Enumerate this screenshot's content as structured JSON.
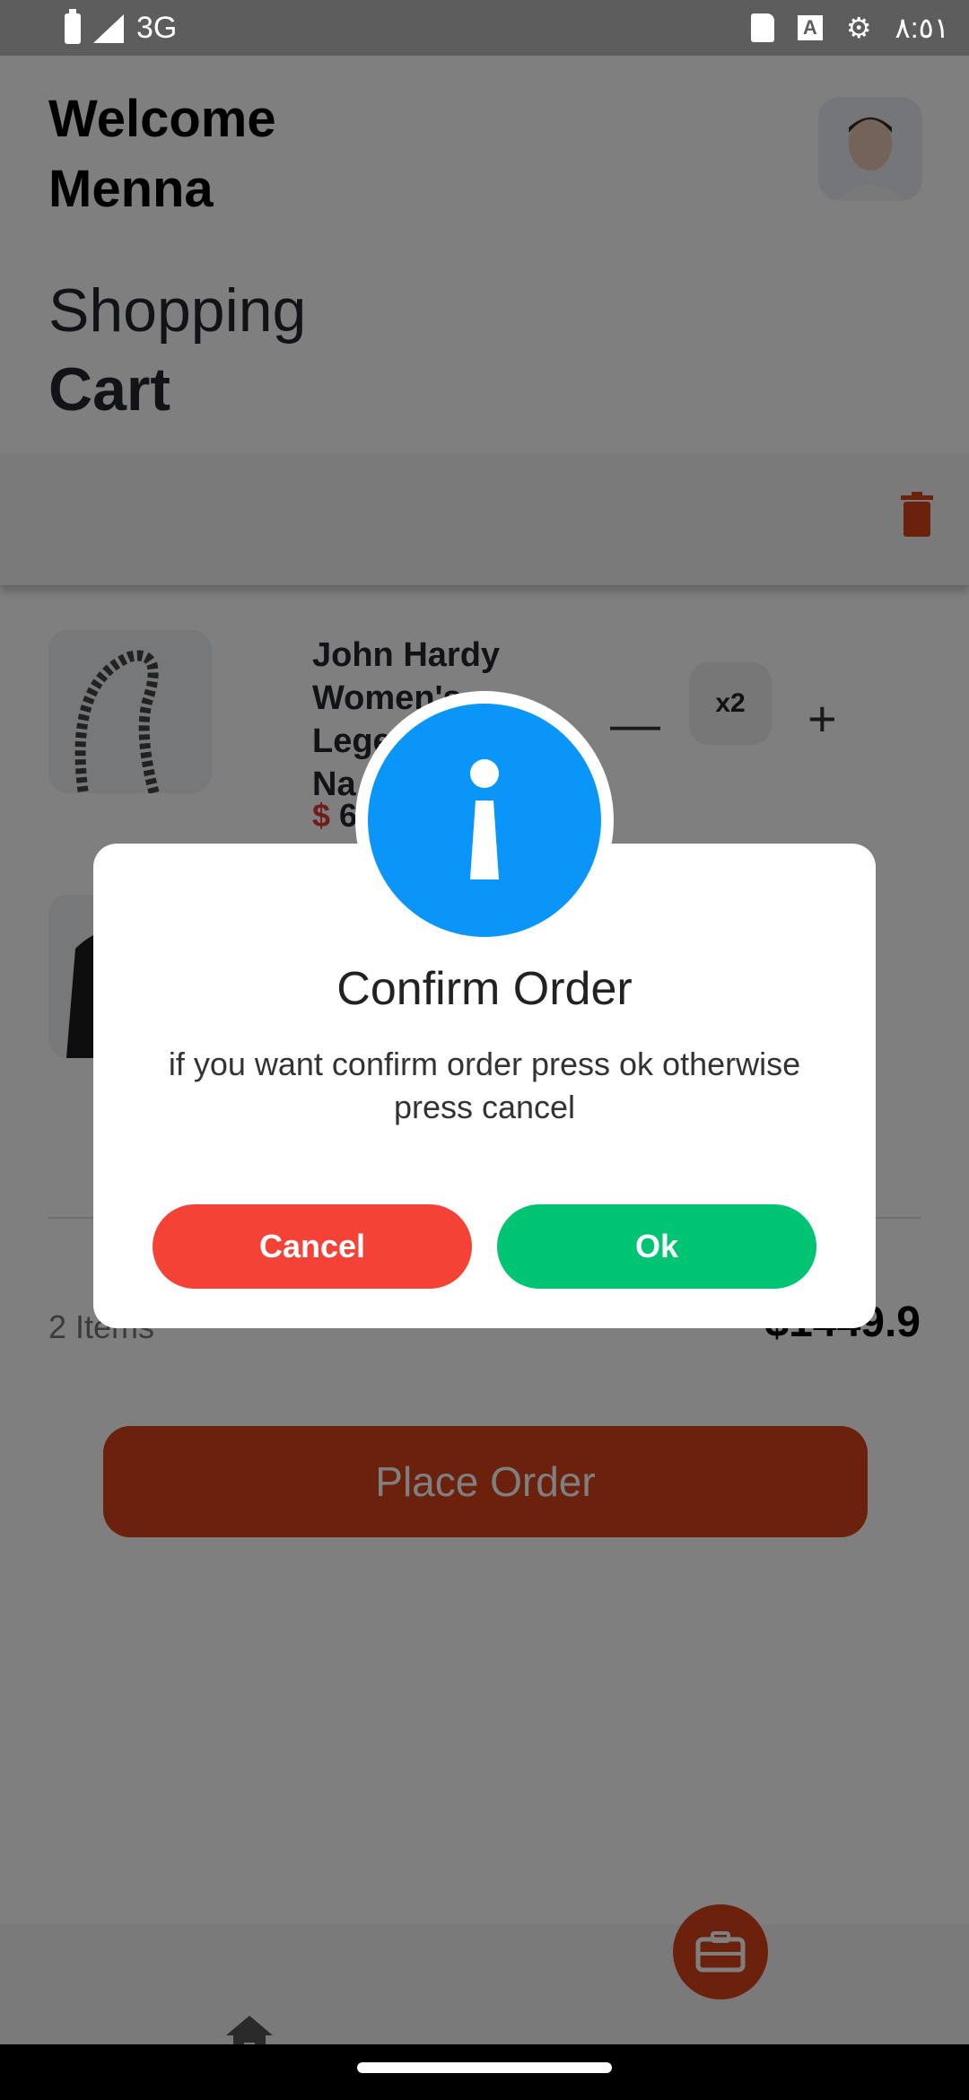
{
  "status_bar": {
    "network": "3G",
    "time": "٨:٥١"
  },
  "header": {
    "welcome_line1": "Welcome",
    "welcome_line2": "Menna"
  },
  "page": {
    "title_light": "Shopping",
    "title_bold": "Cart"
  },
  "cart": {
    "items": [
      {
        "name_lines": [
          "John Hardy",
          "Women's",
          "Lege",
          "Na"
        ],
        "price_currency": "$",
        "price": "6",
        "quantity": "x2",
        "minus": "—",
        "plus": "+"
      }
    ],
    "items_count": "2 Items",
    "total": "$1449.9",
    "place_order_label": "Place Order"
  },
  "dialog": {
    "title": "Confirm Order",
    "message": "if you want confirm order press ok otherwise press cancel",
    "cancel_label": "Cancel",
    "ok_label": "Ok"
  },
  "colors": {
    "accent": "#d9431a",
    "info_blue": "#0a95f8",
    "ok_green": "#00c471",
    "cancel_red": "#f44336"
  },
  "icons": [
    "battery-icon",
    "signal-icon",
    "sd-card-icon",
    "a-icon",
    "wifi-icon",
    "trash-icon",
    "home-icon",
    "briefcase-icon",
    "info-icon"
  ]
}
